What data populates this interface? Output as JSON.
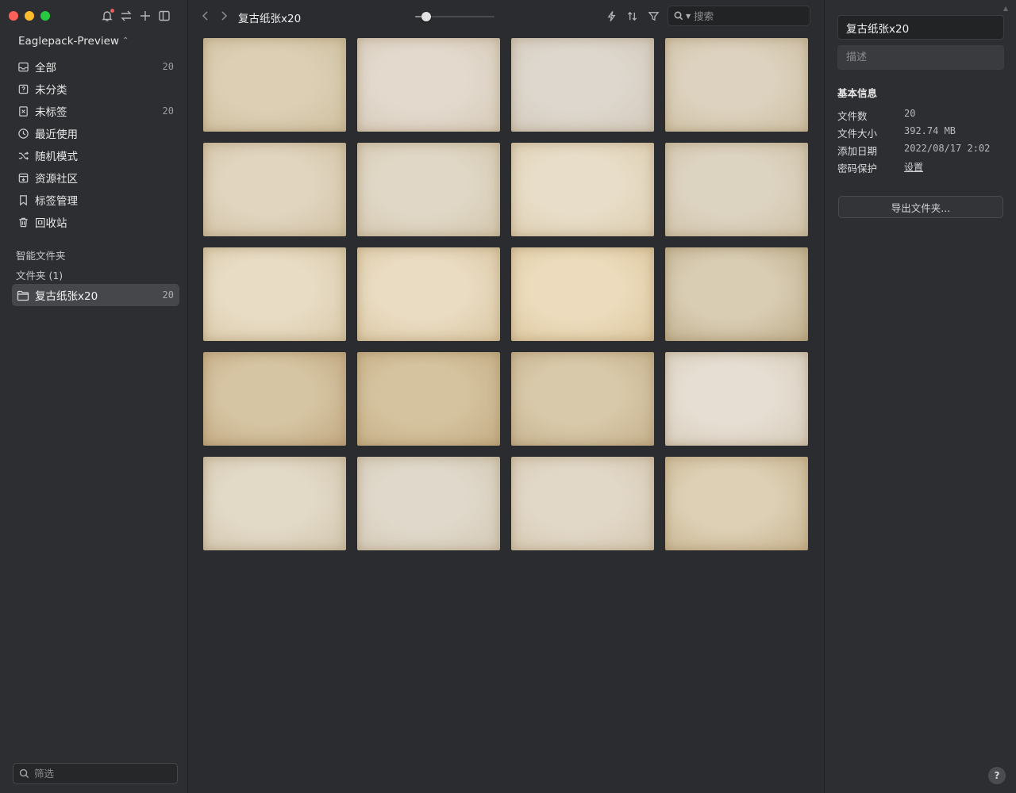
{
  "sidebar": {
    "library_name": "Eaglepack-Preview",
    "items": [
      {
        "label": "全部",
        "count": "20",
        "icon": "inbox-icon"
      },
      {
        "label": "未分类",
        "count": "",
        "icon": "question-box-icon"
      },
      {
        "label": "未标签",
        "count": "20",
        "icon": "untagged-icon"
      },
      {
        "label": "最近使用",
        "count": "",
        "icon": "clock-icon"
      },
      {
        "label": "随机模式",
        "count": "",
        "icon": "shuffle-icon"
      },
      {
        "label": "资源社区",
        "count": "",
        "icon": "community-icon"
      },
      {
        "label": "标签管理",
        "count": "",
        "icon": "bookmark-icon"
      },
      {
        "label": "回收站",
        "count": "",
        "icon": "trash-icon"
      }
    ],
    "smart_folders_title": "智能文件夹",
    "folders_title": "文件夹 (1)",
    "folder": {
      "label": "复古纸张x20",
      "count": "20"
    },
    "filter_placeholder": "筛选"
  },
  "toolbar": {
    "breadcrumb": "复古纸张x20",
    "zoom_level": 0.14,
    "search_placeholder": "搜索"
  },
  "grid": {
    "items": [
      {
        "c1": "#dccfb4",
        "c2": "#cfc0a0"
      },
      {
        "c1": "#e3d9cd",
        "c2": "#d6cbb9"
      },
      {
        "c1": "#ded7cd",
        "c2": "#d2c9bb"
      },
      {
        "c1": "#ddd2bf",
        "c2": "#cdbfa3"
      },
      {
        "c1": "#e1d5c0",
        "c2": "#d1c2a4"
      },
      {
        "c1": "#e0d7c6",
        "c2": "#d3c7ae"
      },
      {
        "c1": "#e8ddc8",
        "c2": "#dccdb0"
      },
      {
        "c1": "#ddd3c1",
        "c2": "#cfc2a8"
      },
      {
        "c1": "#e8dcc5",
        "c2": "#d9c9a8"
      },
      {
        "c1": "#eadcc3",
        "c2": "#dac7a2"
      },
      {
        "c1": "#ecdcbd",
        "c2": "#dcc79f"
      },
      {
        "c1": "#d9cdb4",
        "c2": "#bfae8b"
      },
      {
        "c1": "#d6c5a3",
        "c2": "#c3a983"
      },
      {
        "c1": "#d5c39f",
        "c2": "#c4ad85"
      },
      {
        "c1": "#d8c9aa",
        "c2": "#c5b08c"
      },
      {
        "c1": "#e6ded2",
        "c2": "#d6ccbb"
      },
      {
        "c1": "#e2d9c7",
        "c2": "#d2c6ae"
      },
      {
        "c1": "#e0d8ca",
        "c2": "#d3c9b6"
      },
      {
        "c1": "#e2d8c8",
        "c2": "#d4c7b0"
      },
      {
        "c1": "#ddd0b5",
        "c2": "#c9b591"
      }
    ]
  },
  "inspector": {
    "title": "复古纸张x20",
    "description_placeholder": "描述",
    "section_heading": "基本信息",
    "rows": [
      {
        "key": "文件数",
        "value": "20"
      },
      {
        "key": "文件大小",
        "value": "392.74 MB"
      },
      {
        "key": "添加日期",
        "value": "2022/08/17 2:02"
      },
      {
        "key": "密码保护",
        "value": "设置"
      }
    ],
    "export_label": "导出文件夹...",
    "help_label": "?"
  }
}
